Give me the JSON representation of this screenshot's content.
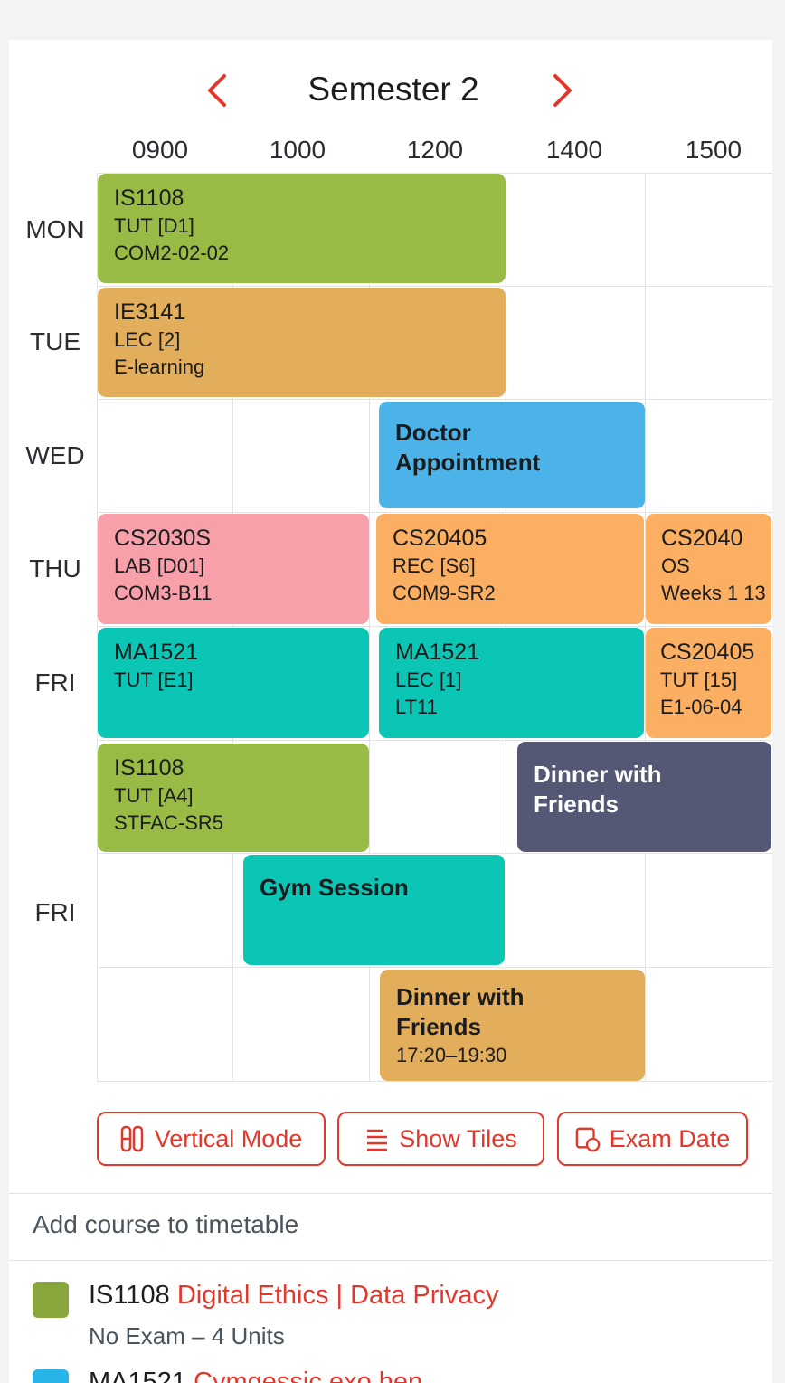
{
  "header": {
    "title": "Semester 2",
    "prev_icon": "chevron-left-icon",
    "next_icon": "chevron-right-icon",
    "accent_color": "#e2382c"
  },
  "time_labels": [
    "0900",
    "1000",
    "1200",
    "1400",
    "1500"
  ],
  "day_labels": [
    "MON",
    "TUE",
    "WED",
    "THU",
    "FRI",
    "FRI"
  ],
  "events": [
    {
      "code": "IS1108",
      "line1": "TUT [D1]",
      "line2": "COM2-02-02",
      "color": "#98bb45"
    },
    {
      "code": "IE3141",
      "line1": "LEC [2]",
      "line2": "E-learning",
      "color": "#e3ae5c"
    },
    {
      "title": "Doctor Appointment",
      "color": "#4bb3e8"
    },
    {
      "code": "CS2030S",
      "line1": "LAB [D01]",
      "line2": "COM3-B11",
      "color": "#f8a0aa"
    },
    {
      "code": "CS20405",
      "line1": "REC [S6]",
      "line2": "COM9-SR2",
      "color": "#fbaf62"
    },
    {
      "code": "CS2040",
      "line1": "OS",
      "line2": "Weeks 1 13",
      "color": "#fbaf62"
    },
    {
      "code": "MA1521",
      "line1": "TUT [E1]",
      "color": "#0cc6b5"
    },
    {
      "code": "MA1521",
      "line1": "LEC [1]",
      "line2": "LT11",
      "color": "#0cc6b5"
    },
    {
      "code": "CS20405",
      "line1": "TUT [15]",
      "line2": "E1-06-04",
      "color": "#fbaf62"
    },
    {
      "code": "IS1108",
      "line1": "TUT [A4]",
      "line2": "STFAC-SR5",
      "color": "#98bb45"
    },
    {
      "title": "Dinner with Friends",
      "color": "#545875"
    },
    {
      "title": "Gym Session",
      "color": "#0cc6b5"
    },
    {
      "title": "Dinner with Friends",
      "time": "17:20–19:30",
      "color": "#e3ae5c"
    }
  ],
  "buttons": {
    "vertical_mode": "Vertical Mode",
    "show_tiles": "Show Tiles",
    "exam_date": "Exam Date"
  },
  "add_course_label": "Add course to timetable",
  "courses": [
    {
      "code": "IS1108",
      "name": "Digital Ethics | Data Privacy",
      "meta": "No Exam – 4 Units",
      "color": "#87a63c"
    },
    {
      "code": "MA1521",
      "name": "Cymgessic exo hen",
      "color": "#27b4e6"
    }
  ]
}
